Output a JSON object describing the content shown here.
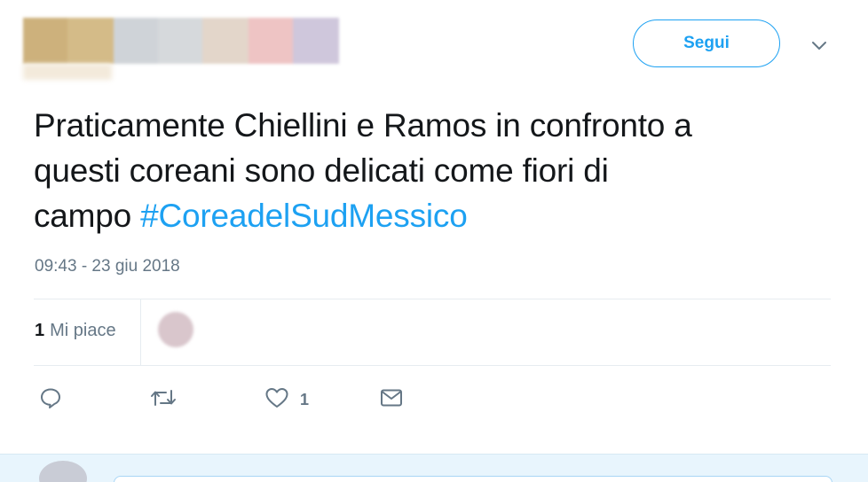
{
  "header": {
    "follow_label": "Segui",
    "menu_icon": "chevron-down-icon"
  },
  "tweet": {
    "text_line1": "Praticamente Chiellini e Ramos in confronto a",
    "text_line2": "questi coreani sono delicati come fiori di",
    "text_line3_prefix": "campo ",
    "hashtag": "#CoreadelSudMessico",
    "timestamp": "09:43 - 23 giu 2018"
  },
  "stats": {
    "likes_count": "1",
    "likes_label": "Mi piace"
  },
  "actions": {
    "reply_icon": "reply-icon",
    "retweet_icon": "retweet-icon",
    "like_icon": "heart-icon",
    "like_count": "1",
    "dm_icon": "envelope-icon"
  },
  "colors": {
    "accent": "#1da1f2",
    "text": "#14171a",
    "muted": "#657786"
  }
}
